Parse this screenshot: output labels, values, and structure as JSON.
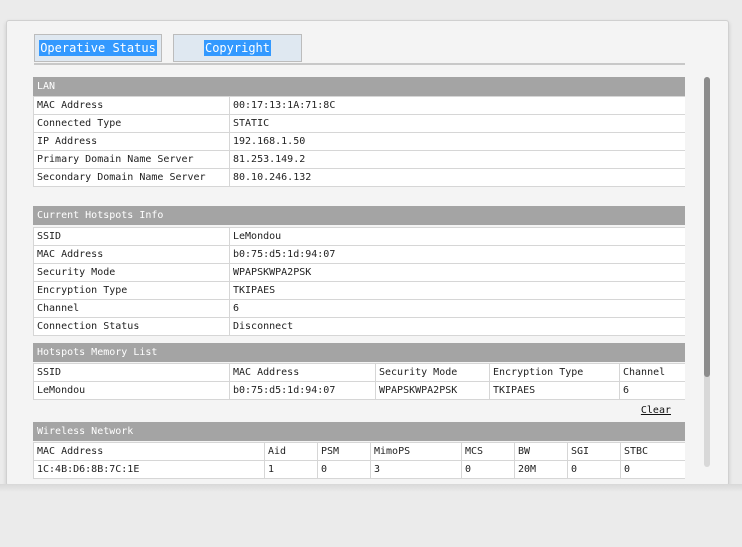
{
  "tabs": [
    {
      "label": "Operative Status",
      "active": true
    },
    {
      "label": "Copyright",
      "active": false
    }
  ],
  "lan": {
    "title": "LAN",
    "rows": [
      {
        "label": "MAC Address",
        "value": "00:17:13:1A:71:8C"
      },
      {
        "label": "Connected Type",
        "value": "STATIC"
      },
      {
        "label": "IP Address",
        "value": "192.168.1.50"
      },
      {
        "label": "Primary Domain Name Server",
        "value": "81.253.149.2"
      },
      {
        "label": "Secondary Domain Name Server",
        "value": "80.10.246.132"
      }
    ]
  },
  "hotspot": {
    "title": "Current Hotspots Info",
    "rows": [
      {
        "label": "SSID",
        "value": "LeMondou"
      },
      {
        "label": "MAC Address",
        "value": "b0:75:d5:1d:94:07"
      },
      {
        "label": "Security Mode",
        "value": "WPAPSKWPA2PSK"
      },
      {
        "label": "Encryption Type",
        "value": "TKIPAES"
      },
      {
        "label": "Channel",
        "value": "6"
      },
      {
        "label": "Connection Status",
        "value": "Disconnect"
      }
    ]
  },
  "memory": {
    "title": "Hotspots Memory List",
    "headers": [
      "SSID",
      "MAC Address",
      "Security Mode",
      "Encryption Type",
      "Channel"
    ],
    "rows": [
      [
        "LeMondou",
        "b0:75:d5:1d:94:07",
        "WPAPSKWPA2PSK",
        "TKIPAES",
        "6"
      ]
    ],
    "clear_label": "Clear"
  },
  "wireless": {
    "title": "Wireless Network",
    "headers": [
      "MAC Address",
      "Aid",
      "PSM",
      "MimoPS",
      "MCS",
      "BW",
      "SGI",
      "STBC"
    ],
    "rows": [
      [
        "1C:4B:D6:8B:7C:1E",
        "1",
        "0",
        "3",
        "0",
        "20M",
        "0",
        "0"
      ]
    ]
  },
  "scroll": {
    "position": 0.0,
    "visible_fraction": 0.77
  }
}
